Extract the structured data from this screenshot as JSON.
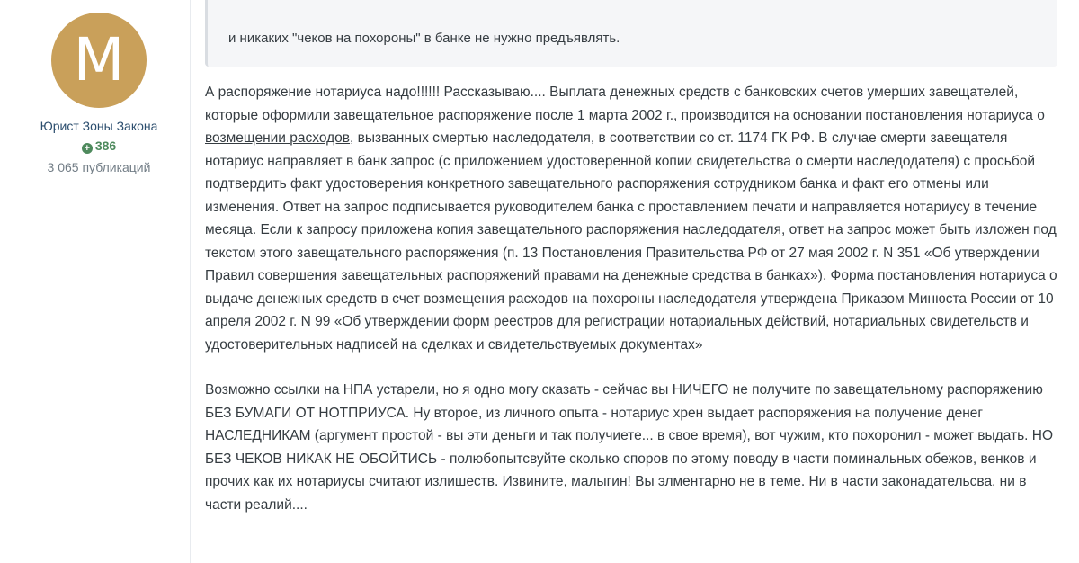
{
  "author": {
    "avatar_letter": "M",
    "avatar_color": "#c9a05a",
    "title": "Юрист Зоны Закона",
    "reputation_icon": "plus-circle-icon",
    "reputation": "386",
    "post_count": "3 065 публикаций"
  },
  "quote": {
    "text": "и никаких \"чеков на похороны\" в банке не нужно предъявлять."
  },
  "post": {
    "p1_before_link": "А распоряжение нотариуса надо!!!!!!  Рассказываю....  Выплата денежных средств с банковских счетов умерших завещателей, которые оформили завещательное распоряжение после 1 марта 2002 г., ",
    "p1_link": "производится на основании постановления нотариуса о возмещении расходов",
    "p1_after_link": ", вызванных смертью наследодателя, в соответствии со ст. 1174 ГК РФ. В случае смерти завещателя нотариус направляет в банк запрос (с приложением удостоверенной копии свидетельства о смерти наследодателя) с просьбой подтвердить факт удостоверения конкретного завещательного распоряжения сотрудником банка и факт его отмены или изменения. Ответ на запрос подписывается руководителем банка с проставлением печати и направляется нотариусу в течение месяца. Если к запросу приложена копия завещательного распоряжения наследодателя, ответ на запрос может быть изложен под текстом этого завещательного распоряжения (п. 13 Постановления Правительства РФ от 27 мая 2002 г. N 351 «Об утверждении Правил совершения завещательных распоряжений правами на денежные средства в банках»). Форма постановления нотариуса о выдаче денежных средств в счет возмещения расходов на похороны наследодателя утверждена Приказом Минюста России от 10 апреля 2002 г. N 99 «Об утверждении форм реестров для регистрации нотариальных действий, нотариальных свидетельств и удостоверительных надписей на сделках и свидетельствуемых документах»",
    "p2": "Возможно ссылки на НПА устарели, но я одно могу сказать - сейчас вы НИЧЕГО не получите по завещательному распоряжению БЕЗ БУМАГИ ОТ НОТПРИУСА. Ну второе, из личного опыта - нотариус хрен выдает распоряжения на получение денег НАСЛЕДНИКАМ (аргумент простой - вы эти деньги и так получиете... в свое время), вот чужим, кто похоронил - может выдать. НО БЕЗ ЧЕКОВ НИКАК НЕ ОБОЙТИСЬ - полюбопытсвуйте сколько споров по этому поводу в части поминальных обежов, венков и прочих как их нотариусы считают излишеств. Извините, малыгин! Вы элментарно не в теме. Ни в части законадательсва, ни в части реалий...."
  }
}
